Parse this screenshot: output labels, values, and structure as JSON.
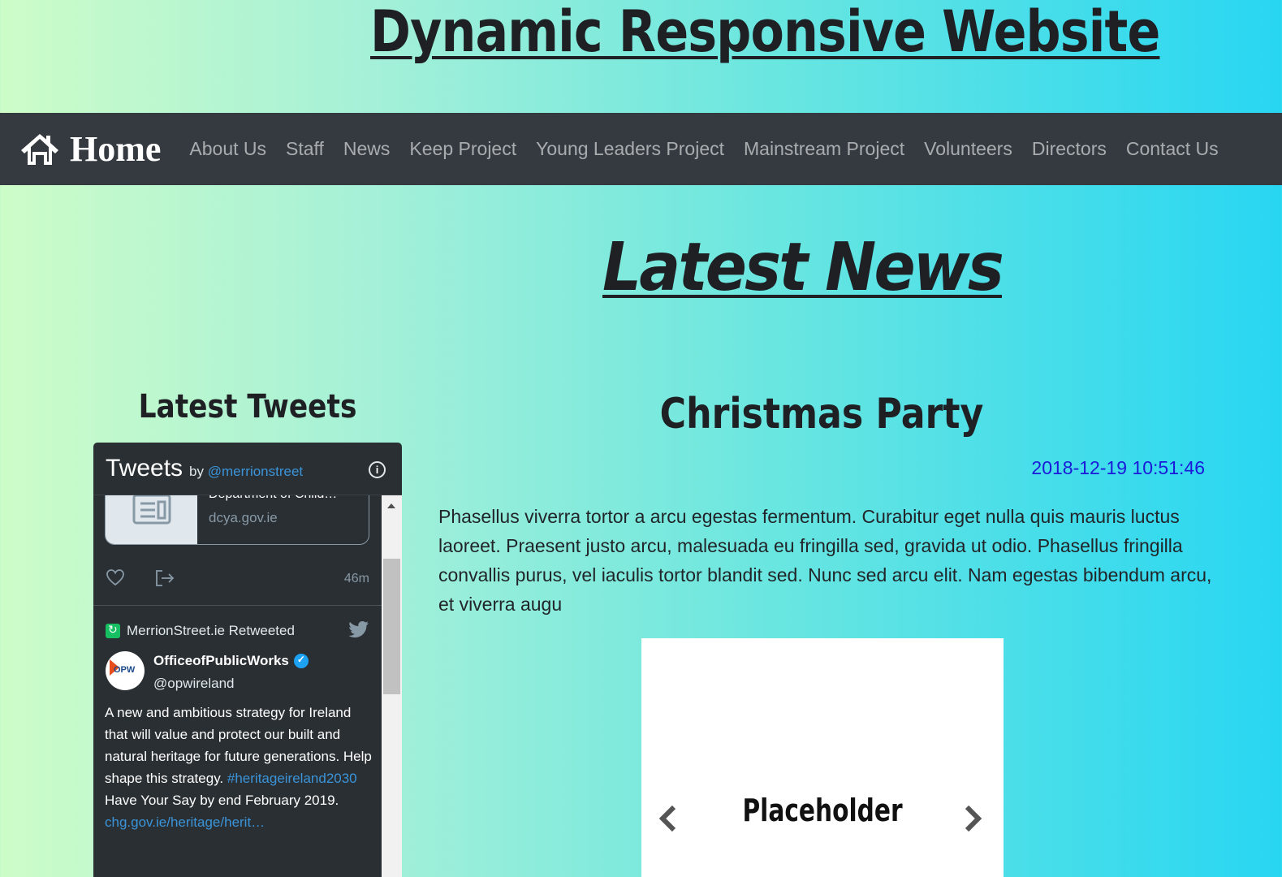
{
  "site": {
    "title": "Dynamic Responsive Website"
  },
  "navbar": {
    "brand": "Home",
    "items": [
      {
        "label": "About Us"
      },
      {
        "label": "Staff"
      },
      {
        "label": "News"
      },
      {
        "label": "Keep Project"
      },
      {
        "label": "Young Leaders Project"
      },
      {
        "label": "Mainstream Project"
      },
      {
        "label": "Volunteers"
      },
      {
        "label": "Directors"
      },
      {
        "label": "Contact Us"
      }
    ]
  },
  "page": {
    "heading": "Latest News"
  },
  "tweets": {
    "heading": "Latest Tweets",
    "widget_title": "Tweets",
    "by": "by",
    "account": "@merrionstreet",
    "link_card": {
      "title": "Department of Child…",
      "domain": "dcya.gov.ie"
    },
    "time": "46m",
    "retweet_label": "MerrionStreet.ie Retweeted",
    "avatar_text": "OPW",
    "user_name": "OfficeofPublicWorks",
    "user_handle": "@opwireland",
    "text_part1": "A new and ambitious strategy for Ireland that will value and protect our built and natural heritage for future generations. Help shape this strategy.",
    "hashtag": "#heritageireland2030",
    "text_part2": " Have Your Say by end February 2019.",
    "link": "chg.gov.ie/heritage/herit…"
  },
  "article": {
    "title": "Christmas Party",
    "date": "2018-12-19 10:51:46",
    "body": "Phasellus viverra tortor a arcu egestas fermentum. Curabitur eget nulla quis mauris luctus laoreet. Praesent justo arcu, malesuada eu fringilla sed, gravida ut odio. Phasellus fringilla convallis purus, vel iaculis tortor blandit sed. Nunc sed arcu elit. Nam egestas bibendum arcu, et viverra augu",
    "carousel": {
      "placeholder": "Placeholder"
    }
  },
  "colors": {
    "navbar_bg": "#343a40",
    "nav_link": "rgba(255,255,255,0.58)",
    "twitter_bg": "#292f33",
    "twitter_link": "#3b94d9",
    "date": "#1a1ad8"
  },
  "icons": [
    "home-icon",
    "info-icon",
    "article-icon",
    "heart-icon",
    "share-icon",
    "retweet-icon",
    "twitter-bird-icon",
    "verified-icon",
    "chevron-left-icon",
    "chevron-right-icon"
  ]
}
